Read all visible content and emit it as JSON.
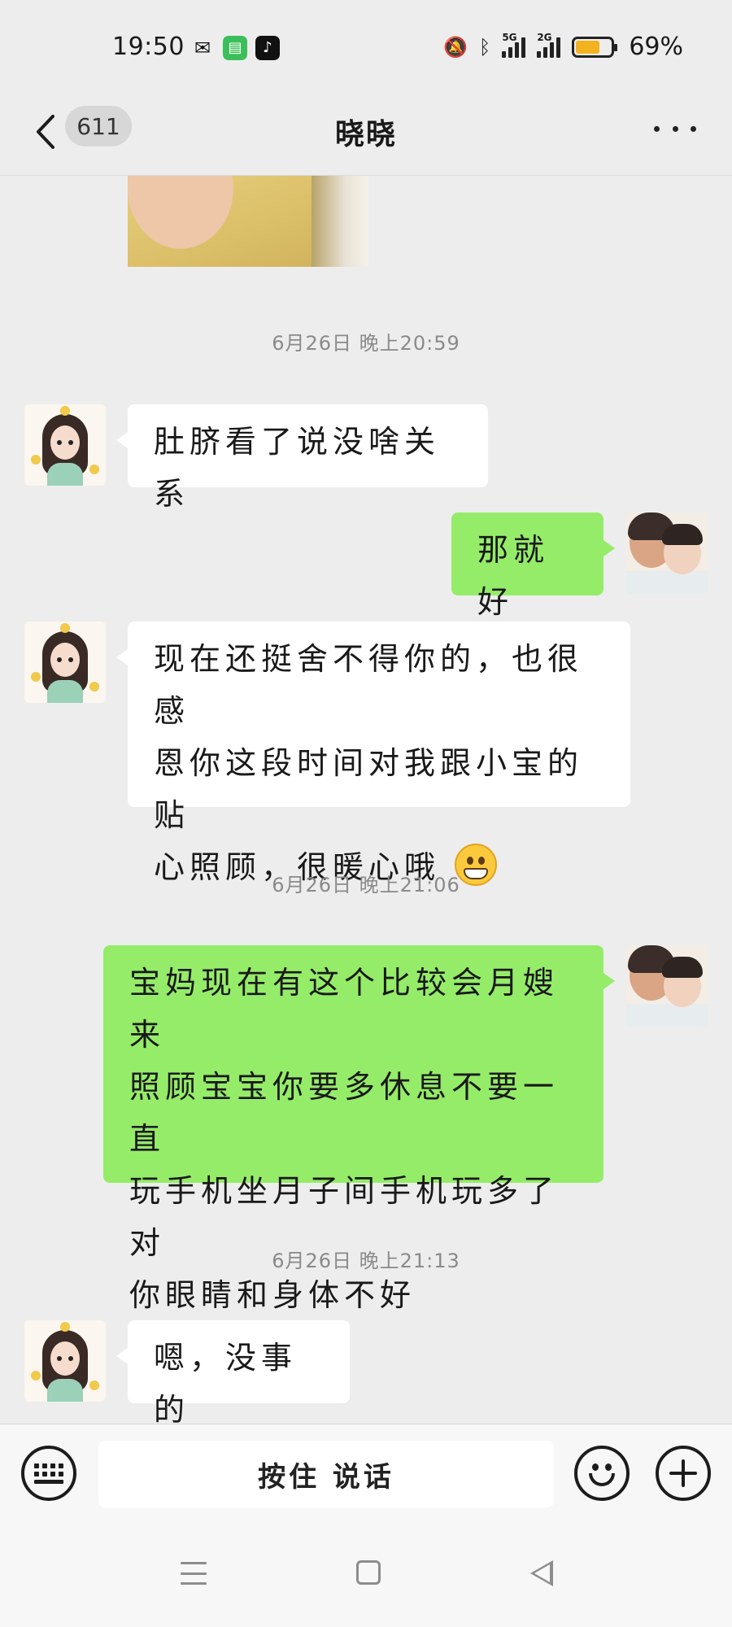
{
  "status_bar": {
    "time": "19:50",
    "notification_icons": [
      "wechat-icon",
      "messages-icon",
      "tiktok-icon"
    ],
    "battery_level": 0.69,
    "battery_percent": "69%",
    "network": [
      "5G",
      "2G"
    ]
  },
  "header": {
    "unread_count": "611",
    "title": "晓晓"
  },
  "messages": {
    "ts_1": "6月26日 晚上20:59",
    "msg_1": "肚脐看了说没啥关系",
    "msg_2": "那就好",
    "msg_3_line1": "现在还挺舍不得你的，也很感",
    "msg_3_line2": "恩你这段时间对我跟小宝的贴",
    "msg_3_line3": "心照顾，很暖心哦",
    "ts_2": "6月26日 晚上21:06",
    "msg_4_line1": "宝妈现在有这个比较会月嫂来",
    "msg_4_line2": "照顾宝宝你要多休息不要一直",
    "msg_4_line3": "玩手机坐月子间手机玩多了对",
    "msg_4_line4": "你眼睛和身体不好",
    "ts_3": "6月26日 晚上21:13",
    "msg_5": "嗯，没事的"
  },
  "input_bar": {
    "hold_to_talk": "按住 说话"
  },
  "colors": {
    "background": "#ededed",
    "outgoing_bubble": "#95ec69",
    "incoming_bubble": "#ffffff",
    "timestamp": "#8a8a8a"
  }
}
